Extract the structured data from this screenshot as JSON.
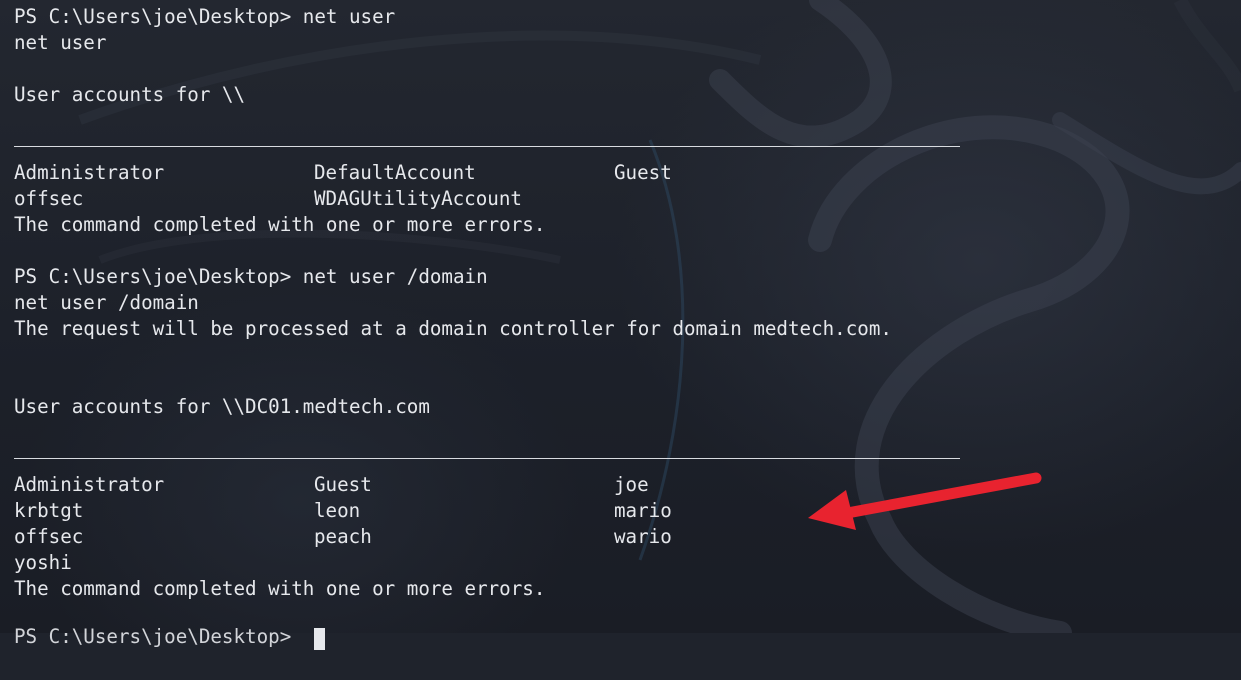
{
  "colors": {
    "background": "#1f232c",
    "text": "#e6e8ec",
    "arrow": "#e8232f"
  },
  "terminal": {
    "block1": {
      "prompt": "PS C:\\Users\\joe\\Desktop> net user",
      "echo": "net user",
      "header": "User accounts for \\\\",
      "rows": [
        [
          "Administrator",
          "DefaultAccount",
          "Guest"
        ],
        [
          "offsec",
          "WDAGUtilityAccount",
          ""
        ]
      ],
      "status": "The command completed with one or more errors."
    },
    "block2": {
      "prompt": "PS C:\\Users\\joe\\Desktop> net user /domain",
      "echo": "net user /domain",
      "info": "The request will be processed at a domain controller for domain medtech.com.",
      "header": "User accounts for \\\\DC01.medtech.com",
      "rows": [
        [
          "Administrator",
          "Guest",
          "joe"
        ],
        [
          "krbtgt",
          "leon",
          "mario"
        ],
        [
          "offsec",
          "peach",
          "wario"
        ],
        [
          "yoshi",
          "",
          ""
        ]
      ],
      "status": "The command completed with one or more errors."
    },
    "next_prompt": "PS C:\\Users\\joe\\Desktop> "
  },
  "annotation": {
    "type": "red-arrow",
    "pointing_to": "domain user list"
  }
}
